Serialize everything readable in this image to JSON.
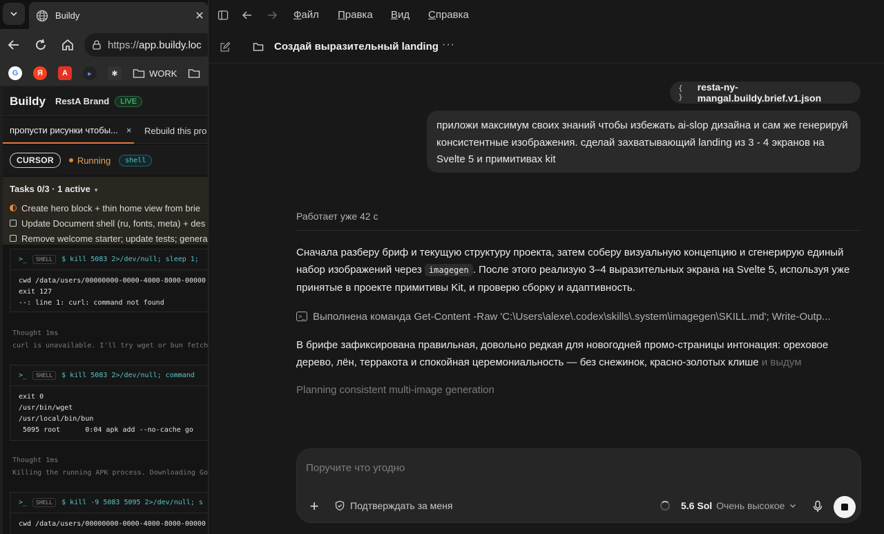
{
  "browser": {
    "tab_title": "Buildy",
    "url_prefix": "https://",
    "url_host": "app.buildy.loc",
    "bookmarks": [
      {
        "icon": "google-icon",
        "letter": "G",
        "color": "#ea4335"
      },
      {
        "icon": "yandex-icon",
        "letter": "Я",
        "color": "#fc3f1d"
      },
      {
        "icon": "aliexpress-icon",
        "letter": "A",
        "color": "#e43225"
      },
      {
        "icon": "dispatch-icon",
        "letter": "▸",
        "color": "#5b8def"
      },
      {
        "icon": "monster-icon",
        "letter": "✱",
        "color": "#dddddd"
      }
    ],
    "bookmark_folder": "WORK"
  },
  "app": {
    "logo": "Buildy",
    "brand": "RestA Brand",
    "live_badge": "LIVE",
    "tabs": [
      {
        "label": "пропусти рисунки чтобы...",
        "close": "×"
      },
      {
        "label": "Rebuild this pro"
      }
    ],
    "status": {
      "agent": "CURSOR",
      "state": "Running",
      "tool": "shell"
    },
    "tasks": {
      "header": "Tasks 0/3 · 1 active",
      "caret": "▾",
      "items": [
        {
          "label": "Create hero block + thin home view from brie",
          "state": "active"
        },
        {
          "label": "Update Document shell (ru, fonts, meta) + des",
          "state": "todo"
        },
        {
          "label": "Remove welcome starter; update tests; genera",
          "state": "todo"
        }
      ]
    },
    "log": {
      "blocks": [
        {
          "prompt": ">_",
          "tag": "SHELL",
          "cmd": "$ kill 5083 2>/dev/null; sleep 1;",
          "body": "cwd /data/users/00000000-0000-4000-8000-00000\nexit 127\n--: line 1: curl: command not found"
        },
        {
          "prompt": ">_",
          "tag": "SHELL",
          "cmd": "$ kill 5083 2>/dev/null; command",
          "body": "exit 0\n/usr/bin/wget\n/usr/local/bin/bun\n 5095 root      0:04 apk add --no-cache go"
        },
        {
          "prompt": ">_",
          "tag": "SHELL",
          "cmd": "$ kill -9 5083 5095 2>/dev/null; s",
          "body": "cwd /data/users/00000000-0000-4000-8000-00000"
        }
      ],
      "thoughts": [
        {
          "label": "Thought 1ms",
          "text": "curl is unavailable. I'll try wget or bun fetch"
        },
        {
          "label": "Thought 1ms",
          "text": "Killing the running APK process. Downloading Go"
        }
      ]
    }
  },
  "chat": {
    "menu": [
      "Файл",
      "Правка",
      "Вид",
      "Справка"
    ],
    "conversation_title": "Создай выразительный landing",
    "more": "···",
    "attachment": {
      "braces": "{ }",
      "name": "resta-ny-mangal.buildy.brief.v1.json"
    },
    "user_message": "приложи максимум своих знаний чтобы избежать ai-slop дизайна и сам же генерируй консистентные изображения. сделай захватывающий landing из 3 - 4 экранов на Svelte 5 и примитивах kit",
    "working_status": "Работает уже 42 с",
    "assistant": {
      "para1_before": "Сначала разберу бриф и текущую структуру проекта, затем соберу визуальную концепцию и сгенерирую единый набор изображений через ",
      "para1_code": "imagegen",
      "para1_after": ". После этого реализую 3–4 выразительных экрана на Svelte 5, используя уже принятые в проекте примитивы Kit, и проверю сборку и адаптивность.",
      "exec_line": "Выполнена команда Get-Content -Raw 'C:\\Users\\alexe\\.codex\\skills\\.system\\imagegen\\SKILL.md'; Write-Outp...",
      "para2": "В брифе зафиксирована правильная, довольно редкая для новогодней промо-страницы интонация: ореховое дерево, лён, терракота и спокойная церемониальность — без снежинок, красно-золотых клише ",
      "para2_fade": "и выдум",
      "planning": "Planning consistent multi-image generation"
    },
    "composer": {
      "placeholder": "Поручите что угодно",
      "approve": "Подтверждать за меня",
      "model": "5.6 Sol",
      "effort": "Очень высокое"
    }
  }
}
